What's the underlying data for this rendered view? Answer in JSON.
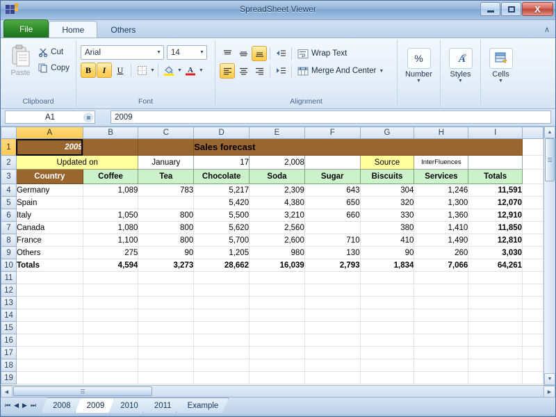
{
  "window": {
    "title": "SpreadSheet Viewer",
    "icon": "spreadsheet-app-icon",
    "minimize": "–",
    "maximize": "□",
    "close": "X"
  },
  "ribbon": {
    "tabs": [
      {
        "label": "File",
        "id": "file"
      },
      {
        "label": "Home",
        "id": "home"
      },
      {
        "label": "Others",
        "id": "others"
      }
    ],
    "collapse_icon": "∧",
    "groups": {
      "clipboard": {
        "label": "Clipboard",
        "paste": "Paste",
        "cut": "Cut",
        "copy": "Copy"
      },
      "font": {
        "label": "Font",
        "font_family": "Arial",
        "font_size": "14",
        "bold": "B",
        "italic": "I",
        "underline": "U",
        "borders": "borders",
        "fill_color": "fill-color",
        "text_color": "A"
      },
      "alignment": {
        "label": "Alignment",
        "wrap_text": "Wrap Text",
        "merge_center": "Merge And Center"
      },
      "number": {
        "label": "Number",
        "icon": "%"
      },
      "styles": {
        "label": "Styles",
        "icon": "A"
      },
      "cells": {
        "label": "Cells",
        "icon": "cells"
      }
    }
  },
  "formula_bar": {
    "name_box": "A1",
    "formula": "2009"
  },
  "grid": {
    "columns": [
      "A",
      "B",
      "C",
      "D",
      "E",
      "F",
      "G",
      "H",
      "I"
    ],
    "selected_column": "A",
    "selected_row": "1",
    "selected_cell": "A1",
    "row_numbers": [
      "1",
      "2",
      "3",
      "4",
      "5",
      "6",
      "7",
      "8",
      "9",
      "10",
      "11",
      "12",
      "13",
      "14",
      "15",
      "16",
      "17",
      "18",
      "19"
    ],
    "row1": {
      "year": "2009",
      "title": "Sales forecast"
    },
    "row2": {
      "updated_on": "Updated on",
      "month": "January",
      "day": "17",
      "year": "2,008",
      "source_label": "Source",
      "source_value": "InterFluences"
    },
    "headers": [
      "Country",
      "Coffee",
      "Tea",
      "Chocolate",
      "Soda",
      "Sugar",
      "Biscuits",
      "Services",
      "Totals"
    ],
    "rows": [
      {
        "country": "Germany",
        "values": [
          "1,089",
          "783",
          "5,217",
          "2,309",
          "643",
          "304",
          "1,246",
          "11,591"
        ]
      },
      {
        "country": "Spain",
        "values": [
          "",
          "",
          "5,420",
          "4,380",
          "650",
          "320",
          "1,300",
          "12,070"
        ]
      },
      {
        "country": "Italy",
        "values": [
          "1,050",
          "800",
          "5,500",
          "3,210",
          "660",
          "330",
          "1,360",
          "12,910"
        ]
      },
      {
        "country": "Canada",
        "values": [
          "1,080",
          "800",
          "5,620",
          "2,560",
          "",
          "380",
          "1,410",
          "11,850"
        ]
      },
      {
        "country": "France",
        "values": [
          "1,100",
          "800",
          "5,700",
          "2,600",
          "710",
          "410",
          "1,490",
          "12,810"
        ]
      },
      {
        "country": "Others",
        "values": [
          "275",
          "90",
          "1,205",
          "980",
          "130",
          "90",
          "260",
          "3,030"
        ]
      }
    ],
    "totals": {
      "country": "Totals",
      "values": [
        "4,594",
        "3,273",
        "28,662",
        "16,039",
        "2,793",
        "1,834",
        "7,066",
        "64,261"
      ]
    }
  },
  "sheet_tabs": {
    "nav": [
      "⏮",
      "◀",
      "▶",
      "⏭"
    ],
    "tabs": [
      {
        "label": "2008",
        "active": false
      },
      {
        "label": "2009",
        "active": true
      },
      {
        "label": "2010",
        "active": false
      },
      {
        "label": "2011",
        "active": false
      },
      {
        "label": "Example",
        "active": false
      }
    ]
  },
  "colors": {
    "brown": "#9a6630",
    "green": "#ccf2cc",
    "yellow": "#ffff9e",
    "selection": "#ffc94e"
  }
}
